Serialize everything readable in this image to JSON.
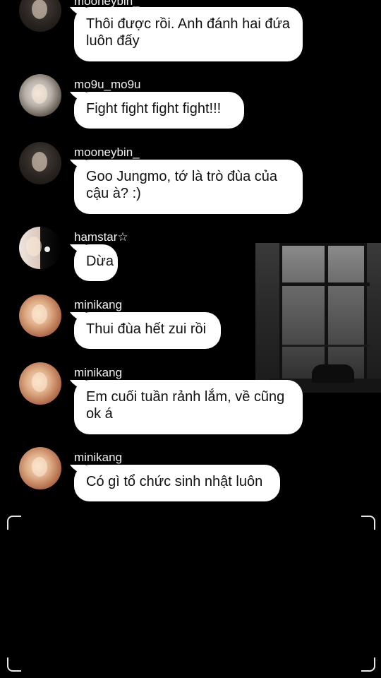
{
  "messages": [
    {
      "username": "mooneybin_",
      "text": "Thôi được rồi. Anh đánh hai đứa luôn đấy",
      "avatar": "user-avatar"
    },
    {
      "username": "mo9u_mo9u",
      "text": "Fight fight fight fight!!!",
      "avatar": "user-avatar"
    },
    {
      "username": "mooneybin_",
      "text": "Goo Jungmo, tớ là trò đùa của cậu à? :)",
      "avatar": "user-avatar"
    },
    {
      "username": "hamstar☆",
      "text": "Dừa",
      "avatar": "user-avatar"
    },
    {
      "username": "minikang",
      "text": "Thui đùa hết zui rồi",
      "avatar": "user-avatar"
    },
    {
      "username": "minikang",
      "text": "Em cuối tuần rảnh lắm, về cũng ok á",
      "avatar": "user-avatar"
    },
    {
      "username": "minikang",
      "text": "Có gì tổ chức sinh nhật luôn",
      "avatar": "user-avatar"
    }
  ],
  "background_image": "window-photo",
  "colors": {
    "bubble": "#ffffff",
    "background": "#000000",
    "username": "#f2f2f2"
  }
}
